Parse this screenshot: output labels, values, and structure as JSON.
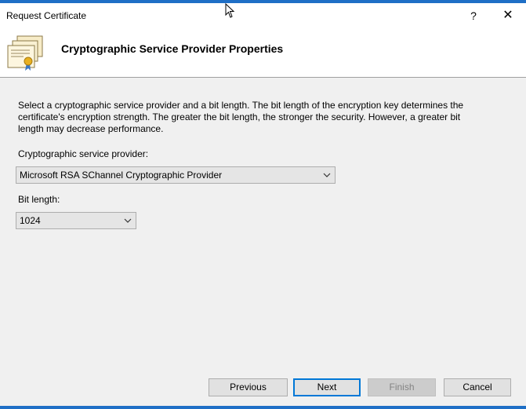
{
  "window": {
    "title": "Request Certificate",
    "help_label": "?",
    "close_label": "✕"
  },
  "header": {
    "heading": "Cryptographic Service Provider Properties",
    "icon": "certificate-icon"
  },
  "content": {
    "description": "Select a cryptographic service provider and a bit length. The bit length of the encryption key determines the certificate's encryption strength. The greater the bit length, the stronger the security. However, a greater bit length may decrease performance.",
    "provider_label": "Cryptographic service provider:",
    "provider_value": "Microsoft RSA SChannel Cryptographic Provider",
    "bit_length_label": "Bit length:",
    "bit_length_value": "1024"
  },
  "footer": {
    "previous_label": "Previous",
    "next_label": "Next",
    "finish_label": "Finish",
    "cancel_label": "Cancel"
  },
  "colors": {
    "accent": "#1f6fc6",
    "focus_border": "#0078d7",
    "dialog_bg": "#f0f0f0"
  }
}
